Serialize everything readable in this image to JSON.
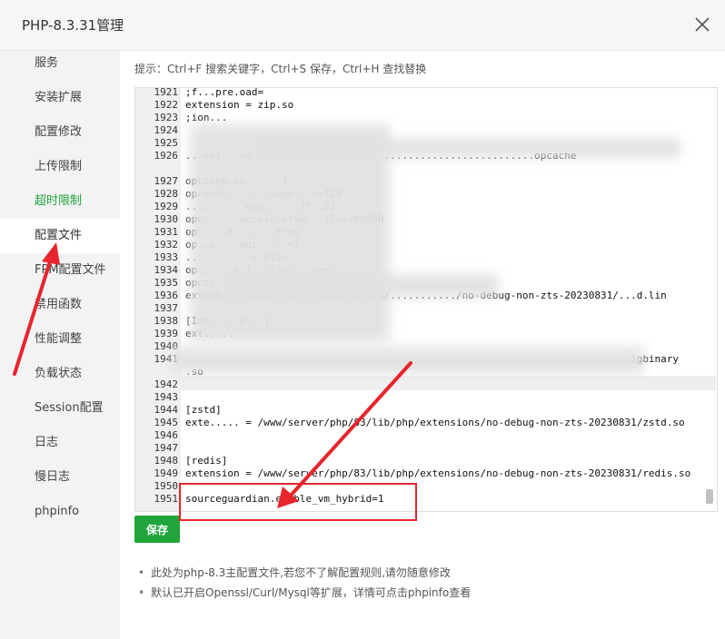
{
  "window": {
    "title": "PHP-8.3.31管理",
    "close_label": "×"
  },
  "sidebar": {
    "items": [
      {
        "label": "服务"
      },
      {
        "label": "安装扩展"
      },
      {
        "label": "配置修改"
      },
      {
        "label": "上传限制"
      },
      {
        "label": "超时限制"
      },
      {
        "label": "配置文件"
      },
      {
        "label": "FPM配置文件"
      },
      {
        "label": "禁用函数"
      },
      {
        "label": "性能调整"
      },
      {
        "label": "负载状态"
      },
      {
        "label": "Session配置"
      },
      {
        "label": "日志"
      },
      {
        "label": "慢日志"
      },
      {
        "label": "phpinfo"
      }
    ],
    "active_index": 5
  },
  "main": {
    "hint": "提示：Ctrl+F 搜索关键字，Ctrl+S 保存，Ctrl+H 查找替换",
    "editor_lines": [
      {
        "n": "1921",
        "t": ";f...pre.oad="
      },
      {
        "n": "1922",
        "t": "extension = zip.so"
      },
      {
        "n": "1923",
        "t": ";ion..."
      },
      {
        "n": "1924",
        "t": ""
      },
      {
        "n": "1925",
        "t": ""
      },
      {
        "n": "1926",
        "t": "...ext...ns...www.........................................opcache"
      },
      {
        "n": "",
        "t": "  .."
      },
      {
        "n": "1927",
        "t": "opcache.en......1"
      },
      {
        "n": "1928",
        "t": "opcache.......sump...n=128"
      },
      {
        "n": "1929",
        "t": "..........ned......ff..32"
      },
      {
        "n": "1930",
        "t": "opc......accelerated...iles=80000"
      },
      {
        "n": "1931",
        "t": "op.....e.......freq"
      },
      {
        "n": "1932",
        "t": "op..a....nut.....=1"
      },
      {
        "n": "1933",
        "t": "...........e_cli=."
      },
      {
        "n": "1934",
        "t": "op......e.j...ffer...ze=..."
      },
      {
        "n": "1935",
        "t": "opcac...jit=..."
      },
      {
        "n": "1936",
        "t": "extens.....www...erver/php/83/lib/.........../no-debug-non-zts-20230831/...d.lin"
      },
      {
        "n": "1937",
        "t": ""
      },
      {
        "n": "1938",
        "t": "[Ima.....g...]"
      },
      {
        "n": "1939",
        "t": "ext....."
      },
      {
        "n": "1940",
        "t": ""
      },
      {
        "n": "1941",
        "t": "..........................................................................igbinary"
      },
      {
        "n": "",
        "t": ".so"
      },
      {
        "n": "1942",
        "t": ""
      },
      {
        "n": "1943",
        "t": ""
      },
      {
        "n": "1944",
        "t": "[zstd]"
      },
      {
        "n": "1945",
        "t": "exte..... = /www/server/php/83/lib/php/extensions/no-debug-non-zts-20230831/zstd.so"
      },
      {
        "n": "1946",
        "t": ""
      },
      {
        "n": "1947",
        "t": ""
      },
      {
        "n": "1948",
        "t": "[redis]"
      },
      {
        "n": "1949",
        "t": "extension = /www/server/php/83/lib/php/extensions/no-debug-non-zts-20230831/redis.so"
      },
      {
        "n": "1950",
        "t": ""
      },
      {
        "n": "1951",
        "t": "sourceguardian.enable_vm_hybrid=1"
      }
    ],
    "save_label": "保存",
    "notes": [
      "此处为php-8.3主配置文件,若您不了解配置规则,请勿随意修改",
      "默认已开启Openssl/Curl/Mysql等扩展，详情可点击phpinfo查看"
    ]
  },
  "colors": {
    "accent": "#20a53a",
    "annotation": "#e8242c"
  }
}
